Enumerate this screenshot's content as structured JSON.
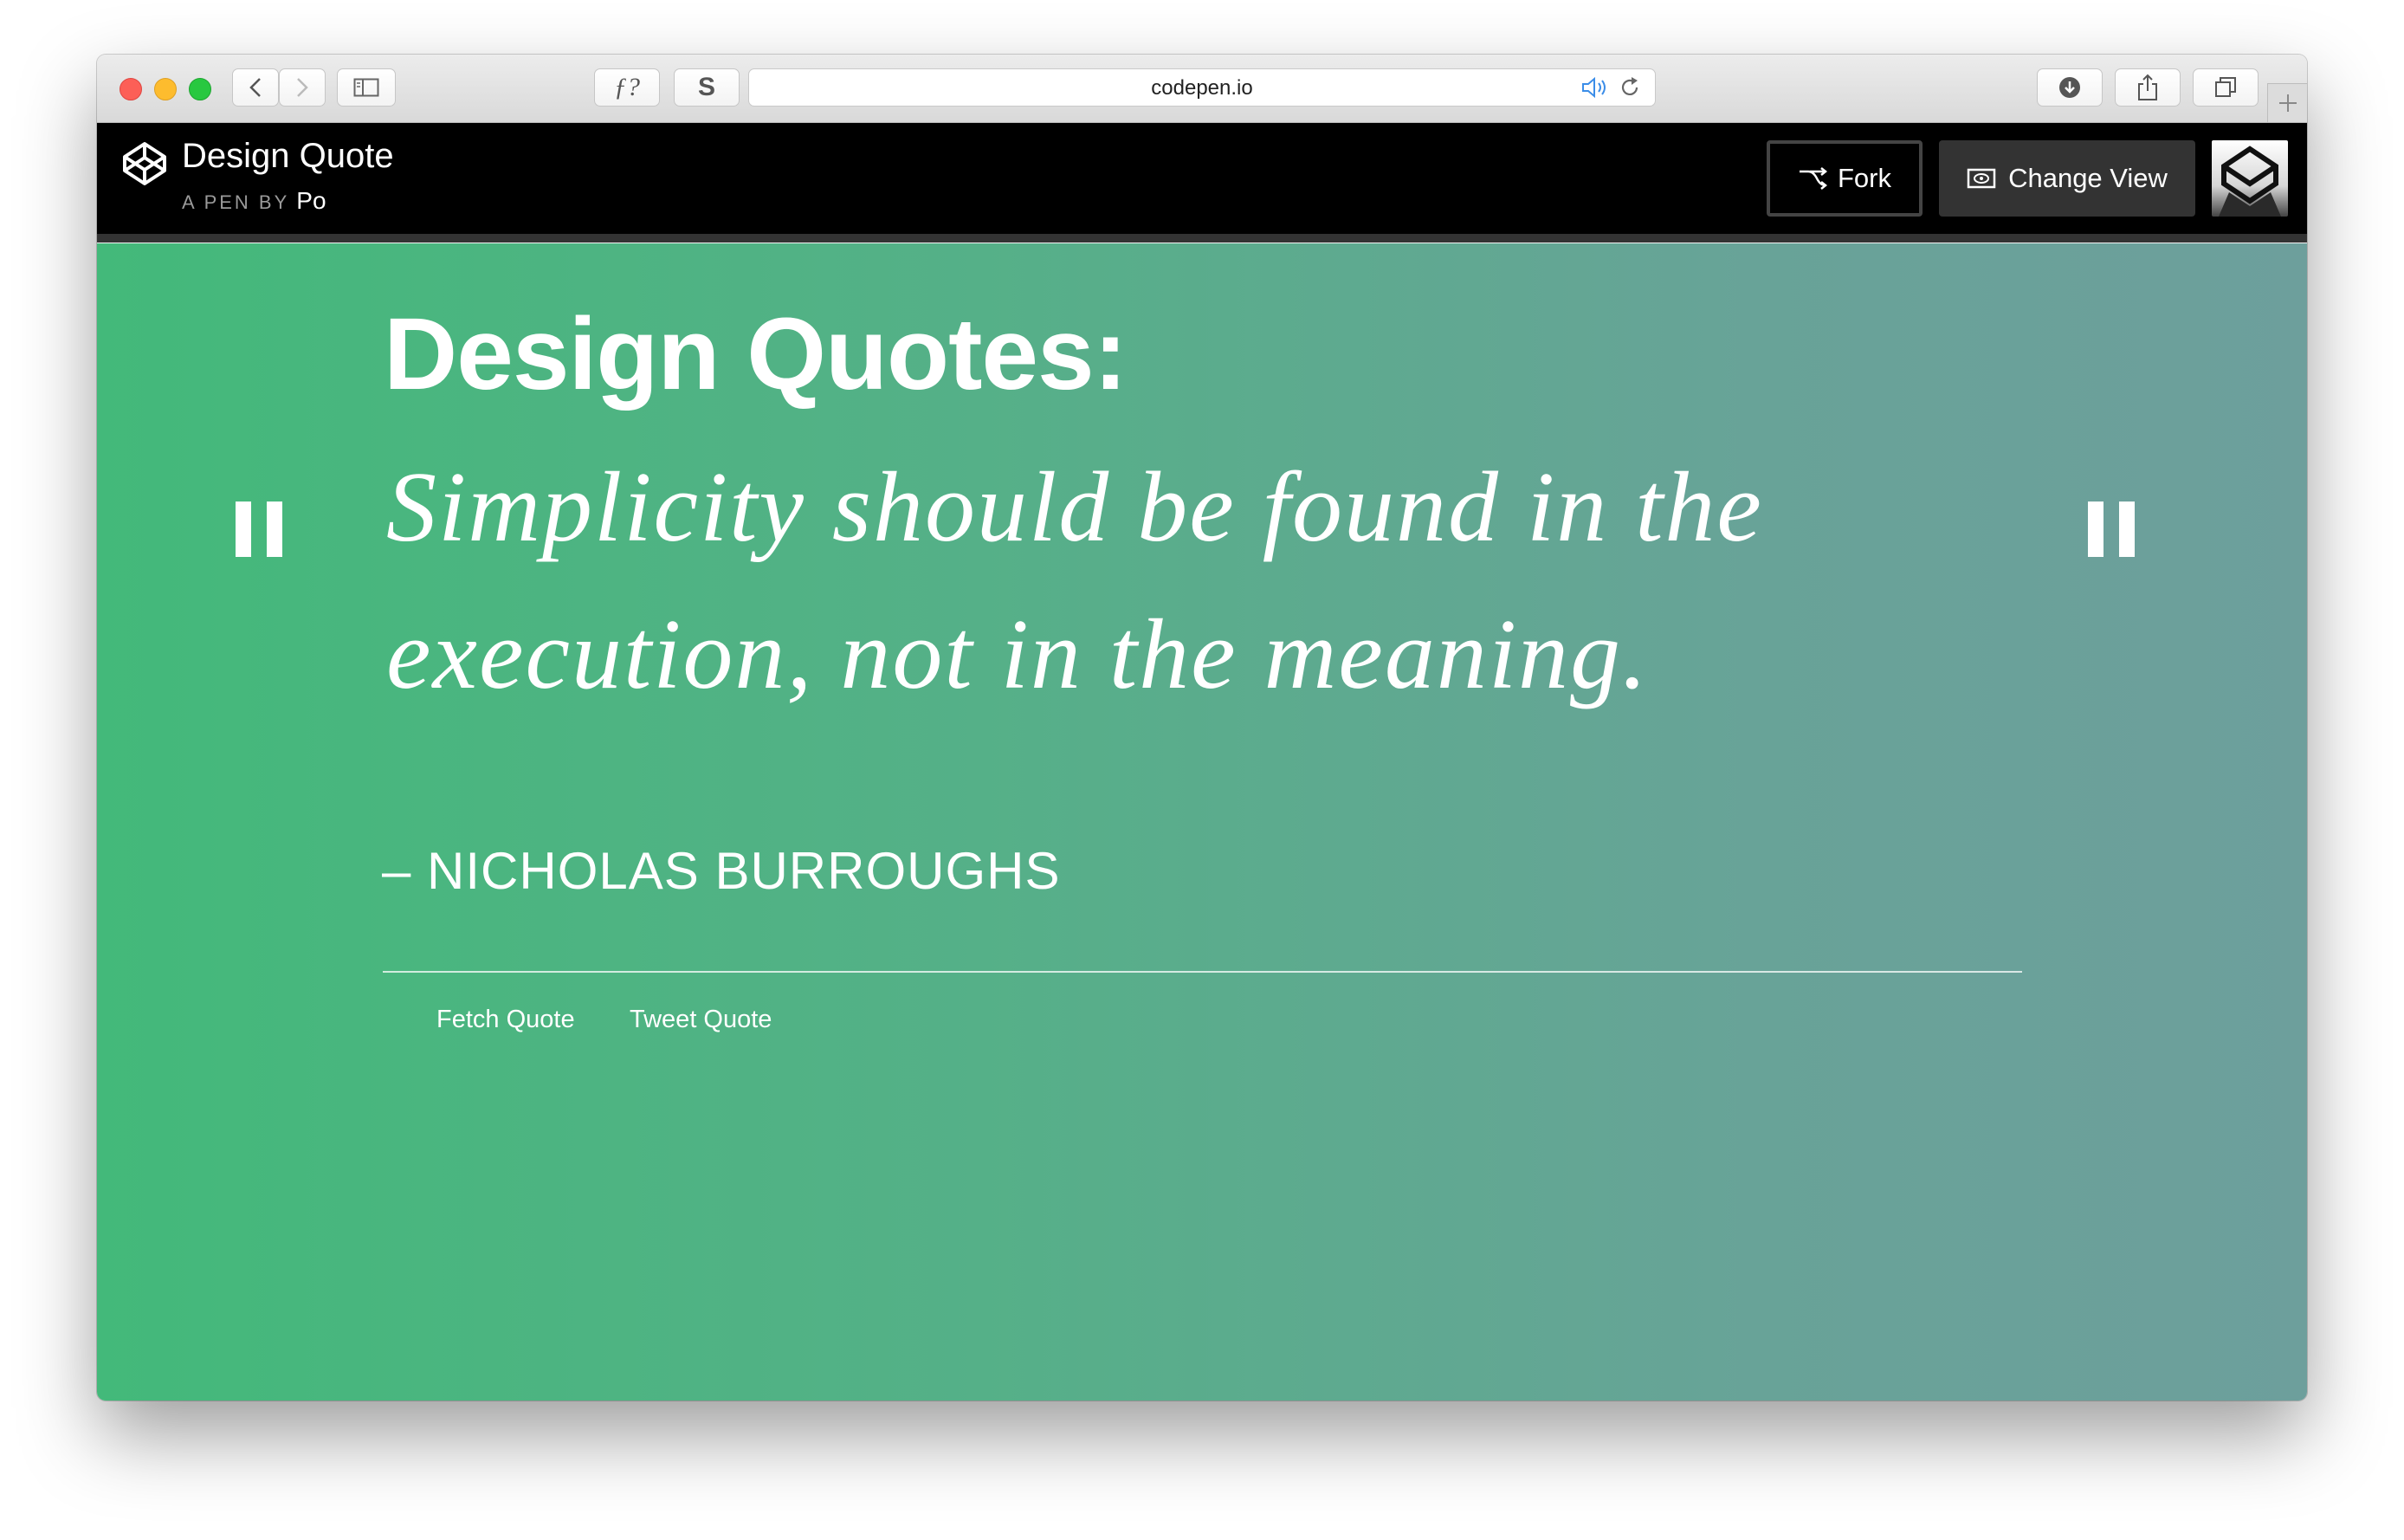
{
  "browser": {
    "url": "codepen.io",
    "toolbar_buttons": {
      "formula": "ƒ?",
      "extension": "S"
    },
    "icons": {
      "back": "chevron-left-icon",
      "forward": "chevron-right-icon",
      "sidebar": "sidebar-icon",
      "audio": "speaker-icon",
      "reload": "reload-icon",
      "downloads": "download-icon",
      "share": "share-icon",
      "tabs": "tabs-icon",
      "new_tab": "plus-icon"
    }
  },
  "codepen": {
    "title": "Design Quote",
    "byline_prefix": "A PEN BY",
    "author": "Po",
    "fork_label": "Fork",
    "change_view_label": "Change View"
  },
  "page": {
    "heading": "Design Quotes:",
    "quote": "Simplicity should be found in the execution, not in the meaning.",
    "author": "– NICHOLAS BURROUGHS",
    "fetch_label": "Fetch Quote",
    "tweet_label": "Tweet Quote"
  },
  "colors": {
    "gradient_start": "#43b97a",
    "gradient_end": "#6d9f9c",
    "header_bg": "#000000",
    "close": "#fc5f57",
    "minimize": "#fdbc2e",
    "zoom": "#28c840"
  }
}
